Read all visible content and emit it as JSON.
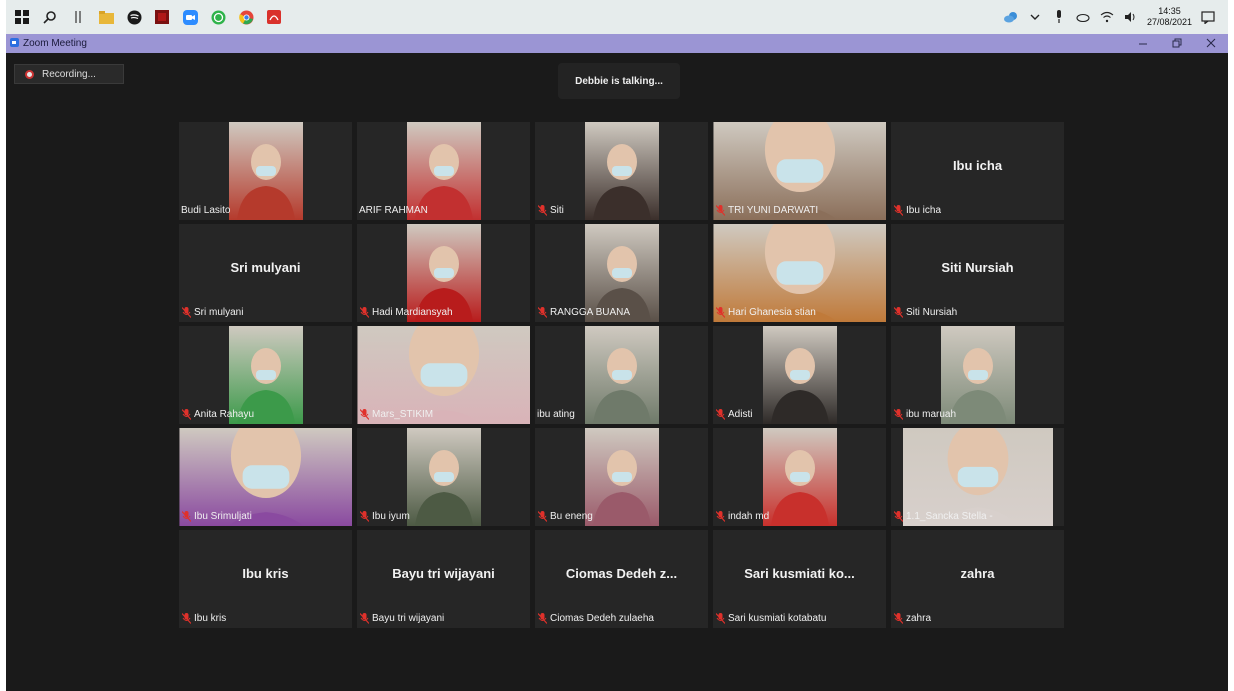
{
  "taskbar": {
    "time": "14:35",
    "date": "27/08/2021"
  },
  "window": {
    "title": "Zoom Meeting"
  },
  "meeting": {
    "recording_label": "Recording...",
    "speaker_banner": "Debbie is talking..."
  },
  "participants": [
    {
      "name": "Budi Lasito",
      "display": "",
      "video": true,
      "muted": false,
      "tone": "#b53a2c"
    },
    {
      "name": "ARIF RAHMAN",
      "display": "",
      "video": true,
      "muted": false,
      "tone": "#c23030"
    },
    {
      "name": "Siti",
      "display": "",
      "video": true,
      "muted": true,
      "tone": "#3b2f2b"
    },
    {
      "name": "TRI YUNI DARWATI",
      "display": "",
      "video": true,
      "muted": true,
      "tone": "#8b6f5a"
    },
    {
      "name": "Ibu icha",
      "display": "Ibu icha",
      "video": false,
      "muted": true,
      "tone": ""
    },
    {
      "name": "Sri mulyani",
      "display": "Sri mulyani",
      "video": false,
      "muted": true,
      "tone": ""
    },
    {
      "name": "Hadi Mardiansyah",
      "display": "",
      "video": true,
      "muted": true,
      "tone": "#b81c1c"
    },
    {
      "name": "RANGGA BUANA",
      "display": "",
      "video": true,
      "muted": true,
      "tone": "#5a5048"
    },
    {
      "name": "Hari Ghanesia stian",
      "display": "",
      "video": true,
      "muted": true,
      "tone": "#c07a3a"
    },
    {
      "name": "Siti Nursiah",
      "display": "Siti Nursiah",
      "video": false,
      "muted": true,
      "tone": ""
    },
    {
      "name": "Anita Rahayu",
      "display": "",
      "video": true,
      "muted": true,
      "tone": "#3c9a4a"
    },
    {
      "name": "Mars_STIKIM",
      "display": "",
      "video": true,
      "muted": true,
      "tone": "#d9b3b8"
    },
    {
      "name": "ibu ating",
      "display": "",
      "video": true,
      "muted": false,
      "tone": "#6f7a6a"
    },
    {
      "name": "Adisti",
      "display": "",
      "video": true,
      "muted": true,
      "tone": "#2e2a28"
    },
    {
      "name": "ibu maruah",
      "display": "",
      "video": true,
      "muted": true,
      "tone": "#7d8a78"
    },
    {
      "name": "Ibu Srimuljati",
      "display": "",
      "video": true,
      "muted": true,
      "tone": "#8a4aa0"
    },
    {
      "name": "Ibu iyum",
      "display": "",
      "video": true,
      "muted": true,
      "tone": "#4d5a44"
    },
    {
      "name": "Bu eneng",
      "display": "",
      "video": true,
      "muted": true,
      "tone": "#9a5a6a"
    },
    {
      "name": "indah md",
      "display": "",
      "video": true,
      "muted": true,
      "tone": "#c8302c"
    },
    {
      "name": "1.1_Sancka Stella -",
      "display": "",
      "video": true,
      "muted": true,
      "tone": "#d8d0cc"
    },
    {
      "name": "Ibu kris",
      "display": "Ibu kris",
      "video": false,
      "muted": true,
      "tone": ""
    },
    {
      "name": "Bayu tri wijayani",
      "display": "Bayu tri wijayani",
      "video": false,
      "muted": true,
      "tone": ""
    },
    {
      "name": "Ciomas Dedeh zulaeha",
      "display": "Ciomas Dedeh z...",
      "video": false,
      "muted": true,
      "tone": ""
    },
    {
      "name": "Sari kusmiati kotabatu",
      "display": "Sari kusmiati ko...",
      "video": false,
      "muted": true,
      "tone": ""
    },
    {
      "name": "zahra",
      "display": "zahra",
      "video": false,
      "muted": true,
      "tone": ""
    }
  ],
  "colors": {
    "accent": "#9b95d4",
    "muted_icon": "#e0312b",
    "background": "#1a1a1a"
  }
}
